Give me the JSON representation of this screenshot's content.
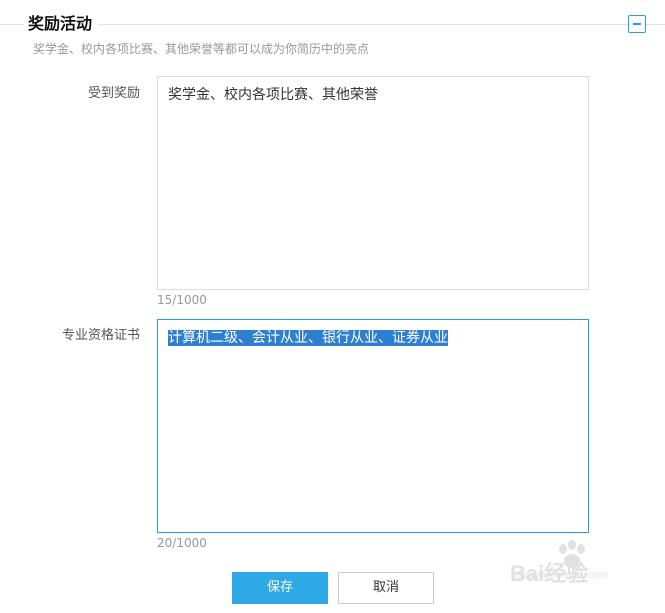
{
  "section": {
    "title": "奖励活动",
    "subtitle": "奖学金、校内各项比赛、其他荣誉等都可以成为你简历中的亮点",
    "collapse_icon": "minus-square-icon"
  },
  "fields": [
    {
      "label": "受到奖励",
      "value": "奖学金、校内各项比赛、其他荣誉",
      "counter": "15/1000"
    },
    {
      "label": "专业资格证书",
      "value": "计算机二级、会计从业、银行从业、证券从业",
      "counter": "20/1000"
    }
  ],
  "actions": {
    "save_label": "保存",
    "cancel_label": "取消"
  },
  "watermark": {
    "text": "Bai经验",
    "sub": "jingyan.baidu.com"
  },
  "colors": {
    "accent": "#2a9ee4",
    "primary_button": "#2fa8e6",
    "selection": "#2f7fd0"
  }
}
